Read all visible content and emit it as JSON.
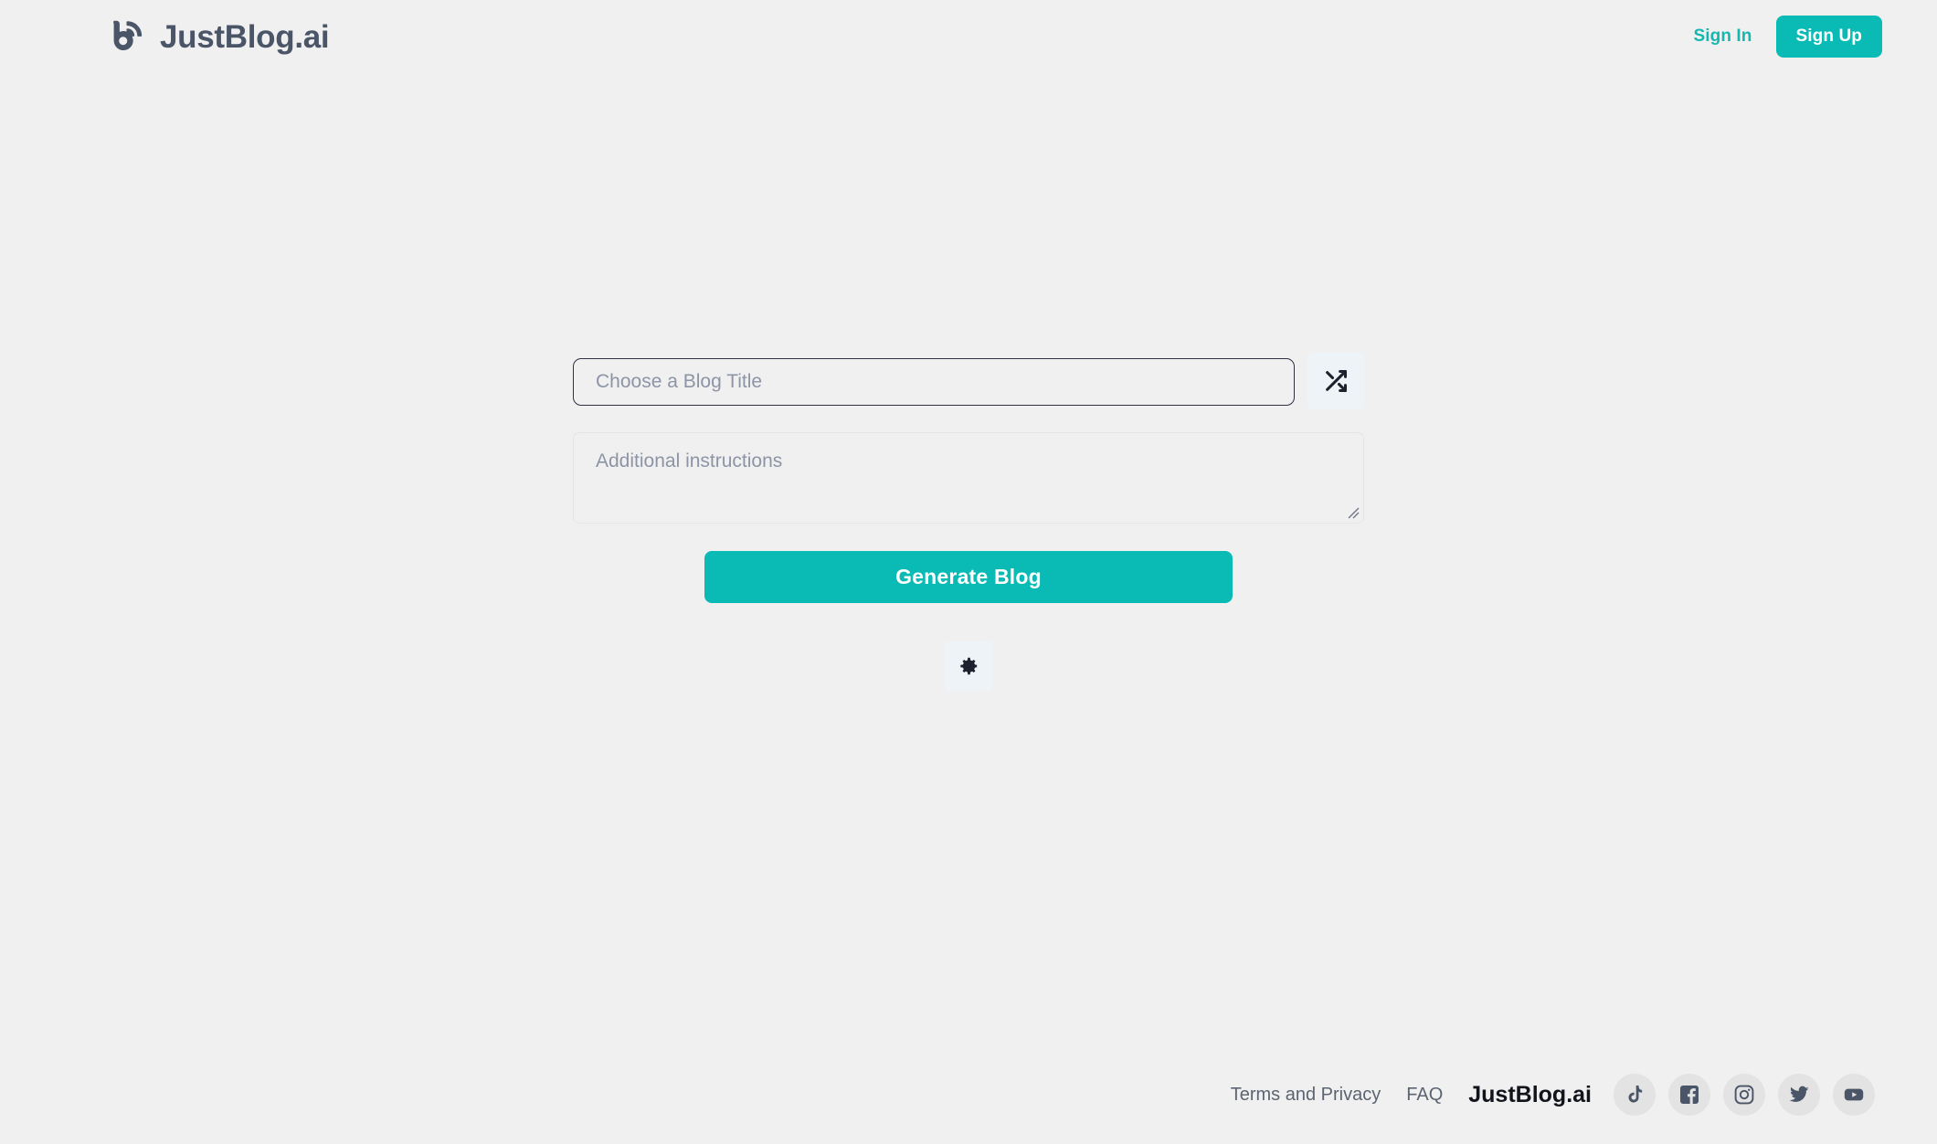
{
  "header": {
    "logo_icon": "blog-broadcast-logo-icon",
    "brand_name": "JustBlog.ai",
    "sign_in_label": "Sign In",
    "sign_up_label": "Sign Up"
  },
  "main": {
    "title_input_value": "",
    "title_input_placeholder": "Choose a Blog Title",
    "shuffle_icon": "shuffle-icon",
    "instructions_value": "",
    "instructions_placeholder": "Additional instructions",
    "generate_label": "Generate Blog",
    "settings_icon": "gear-icon"
  },
  "footer": {
    "terms_label": "Terms and Privacy",
    "faq_label": "FAQ",
    "brand_name": "JustBlog.ai",
    "social": [
      {
        "name": "tiktok",
        "icon": "tiktok-icon"
      },
      {
        "name": "facebook",
        "icon": "facebook-icon"
      },
      {
        "name": "instagram",
        "icon": "instagram-icon"
      },
      {
        "name": "twitter",
        "icon": "twitter-icon"
      },
      {
        "name": "youtube",
        "icon": "youtube-icon"
      }
    ]
  },
  "colors": {
    "accent_teal": "#0abab5",
    "page_background": "#f0f0f0",
    "text_slate": "#4a5568",
    "placeholder_gray": "#8d94a5",
    "social_circle": "#e3e3e3"
  }
}
